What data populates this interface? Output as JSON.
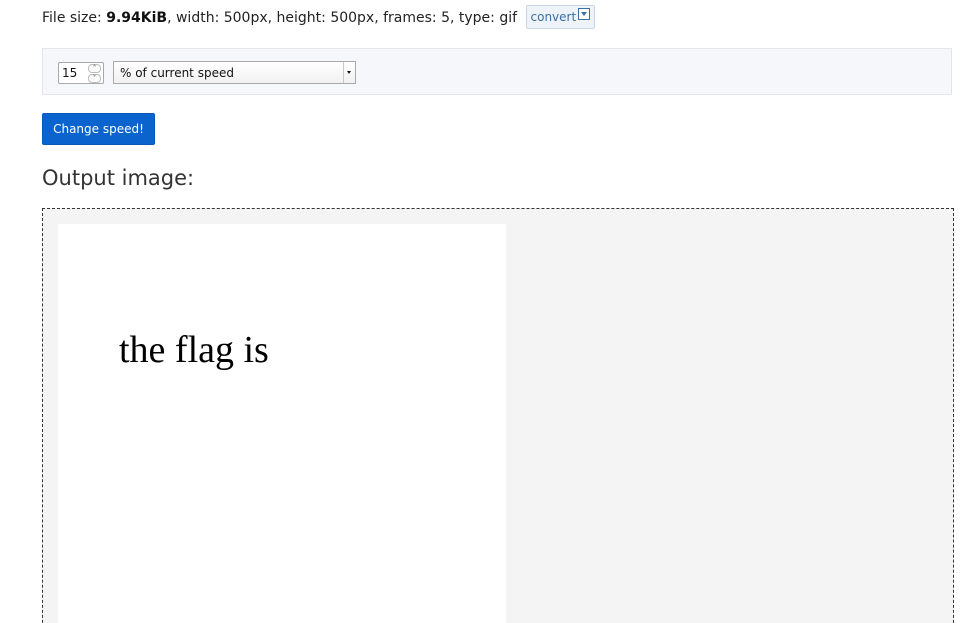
{
  "file_info": {
    "size_label": "File size: ",
    "size_value": "9.94KiB",
    "details": ", width: 500px, height: 500px, frames: 5, type: gif",
    "convert_label": "convert"
  },
  "speed_form": {
    "number_value": "15",
    "spinner_up_icon": "chevron-up-icon",
    "spinner_down_icon": "chevron-down-icon",
    "mode_selected": "% of current speed",
    "submit_label": "Change speed!"
  },
  "output": {
    "heading": "Output image:",
    "image_text": "the flag is"
  },
  "colors": {
    "primary_button": "#0b63ce",
    "panel_background": "#f5f7fa",
    "output_background": "#f4f4f4"
  }
}
